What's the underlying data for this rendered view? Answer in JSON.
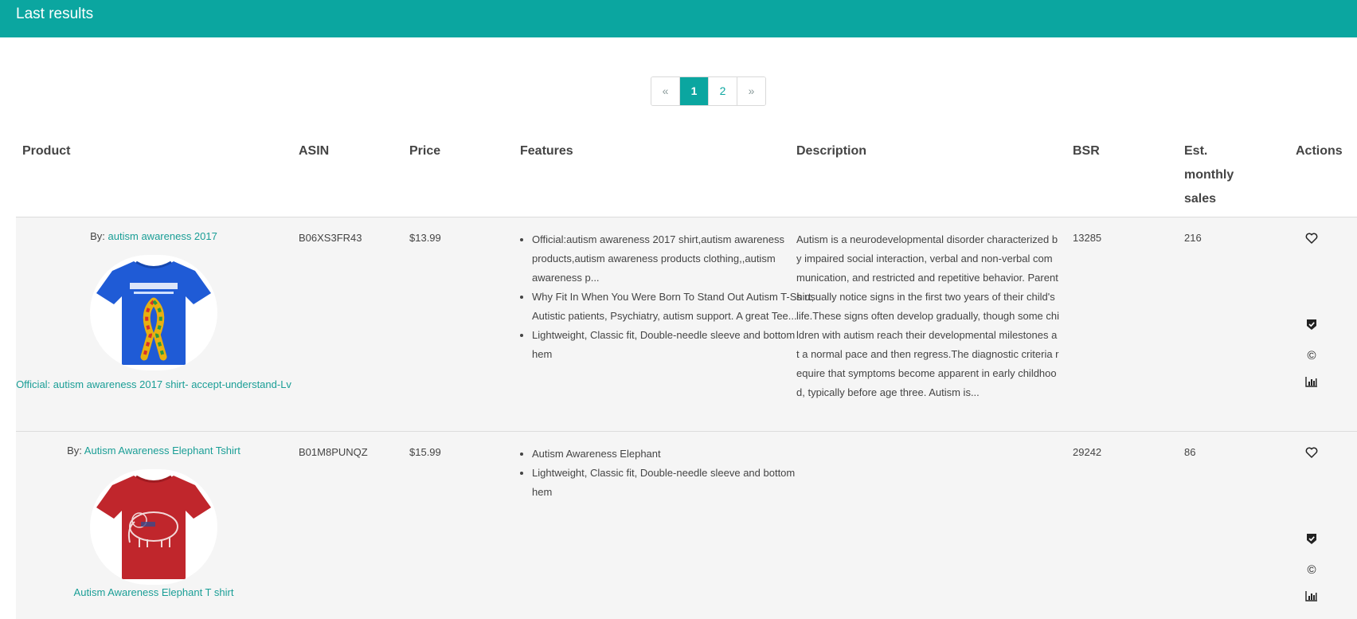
{
  "header": {
    "title": "Last results"
  },
  "pagination": {
    "prev": "«",
    "pages": [
      "1",
      "2"
    ],
    "active": "1",
    "next": "»"
  },
  "table": {
    "columns": [
      "Product",
      "ASIN",
      "Price",
      "Features",
      "Description",
      "BSR",
      "Est. monthly sales",
      "Actions"
    ],
    "rows": [
      {
        "by_prefix": "By: ",
        "brand": "autism awareness 2017",
        "title": "Official: autism awareness 2017 shirt- accept-understand-Lv",
        "asin": "B06XS3FR43",
        "price": "$13.99",
        "features": [
          "Official:autism awareness 2017 shirt,autism awareness products,autism awareness products clothing,,autism awareness p...",
          "Why Fit In When You Were Born To Stand Out Autism T-Shirt, Autistic patients, Psychiatry, autism support. A great Tee...",
          "Lightweight, Classic fit, Double-needle sleeve and bottom hem"
        ],
        "description": "Autism is a neurodevelopmental disorder characterized by impaired social interaction, verbal and non-verbal communication, and restricted and repetitive behavior. Parents usually notice signs in the first two years of their child's life.These signs often develop gradually, though some children with autism reach their developmental milestones at a normal pace and then regress.The diagnostic criteria require that symptoms become apparent in early childhood, typically before age three. Autism is...",
        "bsr": "13285",
        "sales": "216",
        "shirt_color": "#1f5bd6",
        "design": "ribbon"
      },
      {
        "by_prefix": "By: ",
        "brand": "Autism Awareness Elephant Tshirt",
        "title": "Autism Awareness Elephant T shirt",
        "asin": "B01M8PUNQZ",
        "price": "$15.99",
        "features": [
          "Autism Awareness Elephant",
          "Lightweight, Classic fit, Double-needle sleeve and bottom hem"
        ],
        "description": "",
        "bsr": "29242",
        "sales": "86",
        "shirt_color": "#c0262c",
        "design": "elephant"
      }
    ]
  },
  "actions": {
    "icons": [
      "heart-icon",
      "shield-check-icon",
      "copyright-icon",
      "bar-chart-icon"
    ]
  },
  "colors": {
    "accent": "#0ba6a0",
    "link": "#1a9e96",
    "row_bg": "#f5f5f5"
  }
}
